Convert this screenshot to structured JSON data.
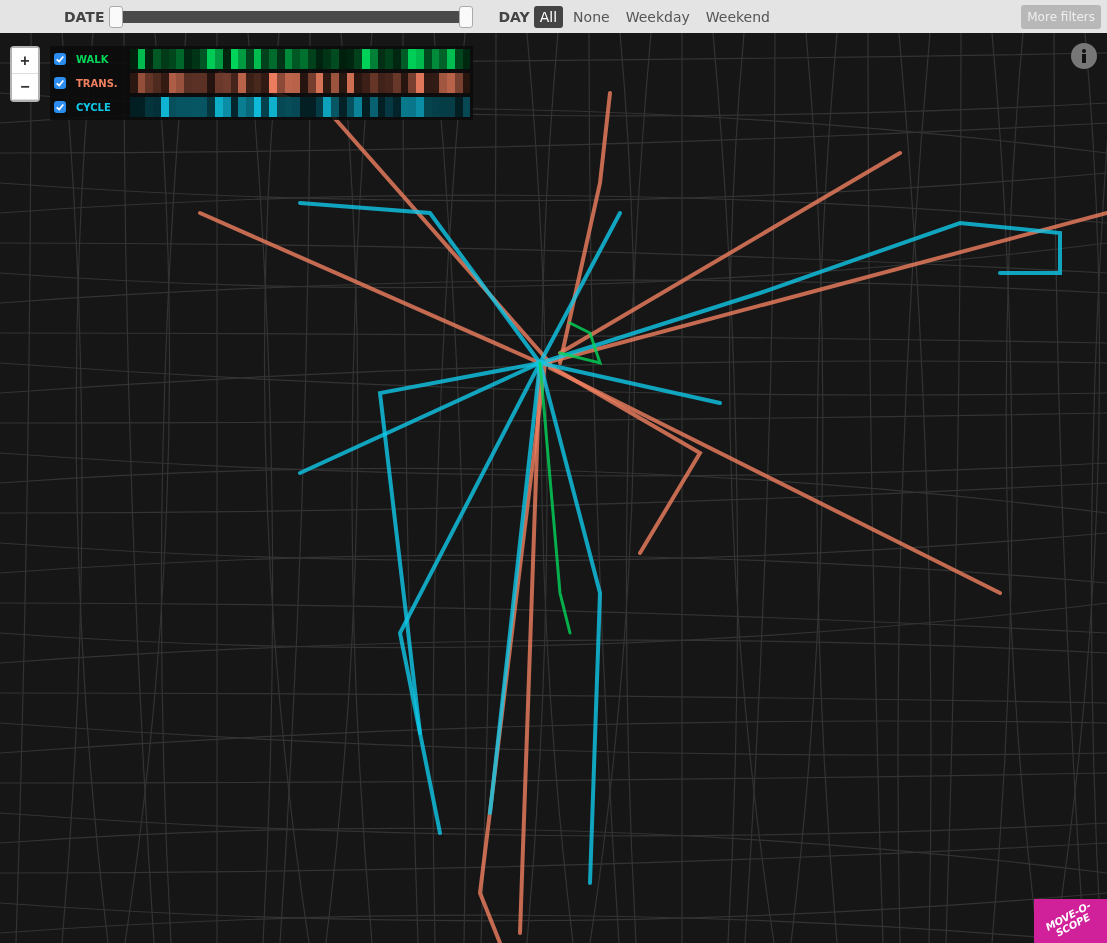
{
  "filters": {
    "date": {
      "label": "DATE",
      "level": 1
    },
    "day": {
      "label": "DAY",
      "options": [
        {
          "label": "All",
          "selected": true
        },
        {
          "label": "None",
          "selected": false
        },
        {
          "label": "Weekday",
          "selected": false
        },
        {
          "label": "Weekend",
          "selected": false
        }
      ]
    },
    "more_filters": {
      "label": "More filters",
      "disabled": true
    }
  },
  "zoom": {
    "in": "+",
    "out": "−"
  },
  "modes": [
    {
      "label": "WALK",
      "checked": true,
      "color": "#00d65a"
    },
    {
      "label": "TRANS.",
      "checked": true,
      "color": "#f08060"
    },
    {
      "label": "CYCLE",
      "checked": true,
      "color": "#10c8e8"
    }
  ],
  "logo": {
    "lines": [
      "MOVE-O-",
      "SCOPE"
    ]
  }
}
